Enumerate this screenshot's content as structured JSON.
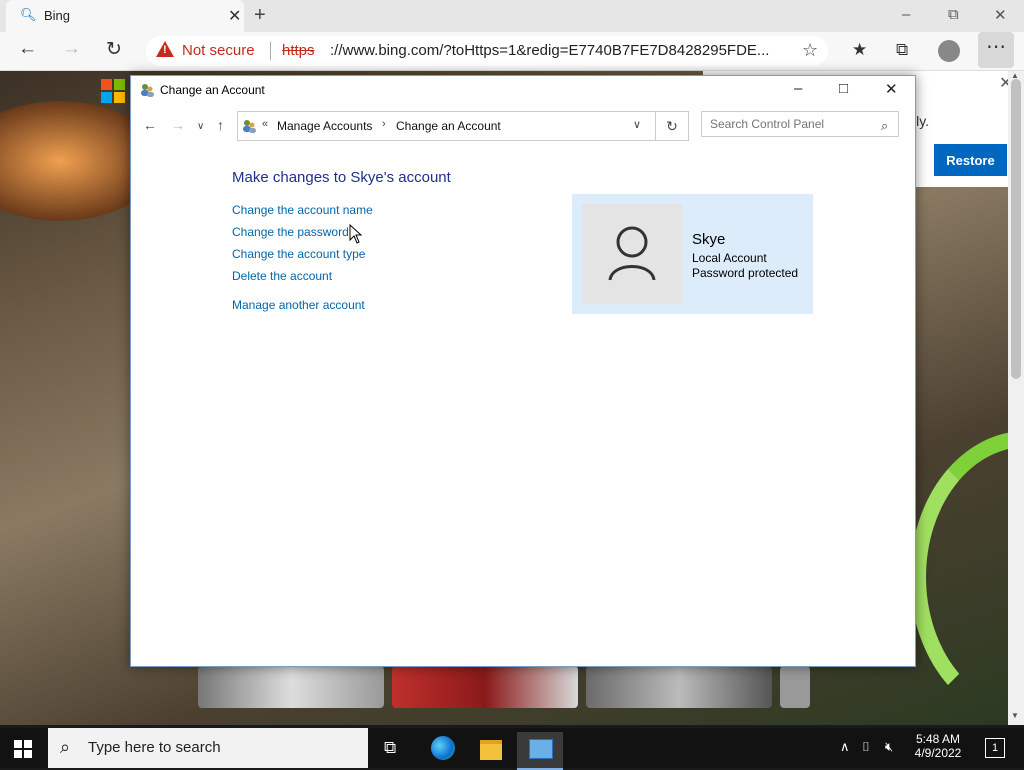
{
  "browser": {
    "tab_title": "Bing",
    "tab_close": "✕",
    "new_tab": "+",
    "not_secure": "Not secure",
    "url_scheme": "https",
    "url_rest": "://www.bing.com/?toHttps=1&redig=E7740B7FE7D8428295FDE..."
  },
  "page": {
    "notification_text": "lly.",
    "restore_label": "Restore"
  },
  "cp": {
    "window_title": "Change an Account",
    "breadcrumb_prefix": "«",
    "breadcrumb": [
      {
        "label": "Manage Accounts"
      },
      {
        "label": "Change an Account"
      }
    ],
    "search_placeholder": "Search Control Panel",
    "heading": "Make changes to Skye's account",
    "links": [
      {
        "label": "Change the account name"
      },
      {
        "label": "Change the password"
      },
      {
        "label": "Change the account type"
      },
      {
        "label": "Delete the account"
      },
      {
        "label": "Manage another account"
      }
    ],
    "account": {
      "name": "Skye",
      "type": "Local Account",
      "status": "Password protected"
    }
  },
  "taskbar": {
    "search_placeholder": "Type here to search",
    "time": "5:48 AM",
    "date": "4/9/2022",
    "notification_count": "1"
  },
  "icons": {
    "accent": "#0067c0",
    "link_color": "#0066aa",
    "heading_color": "#1e3287",
    "warning_color": "#c42b1c"
  }
}
